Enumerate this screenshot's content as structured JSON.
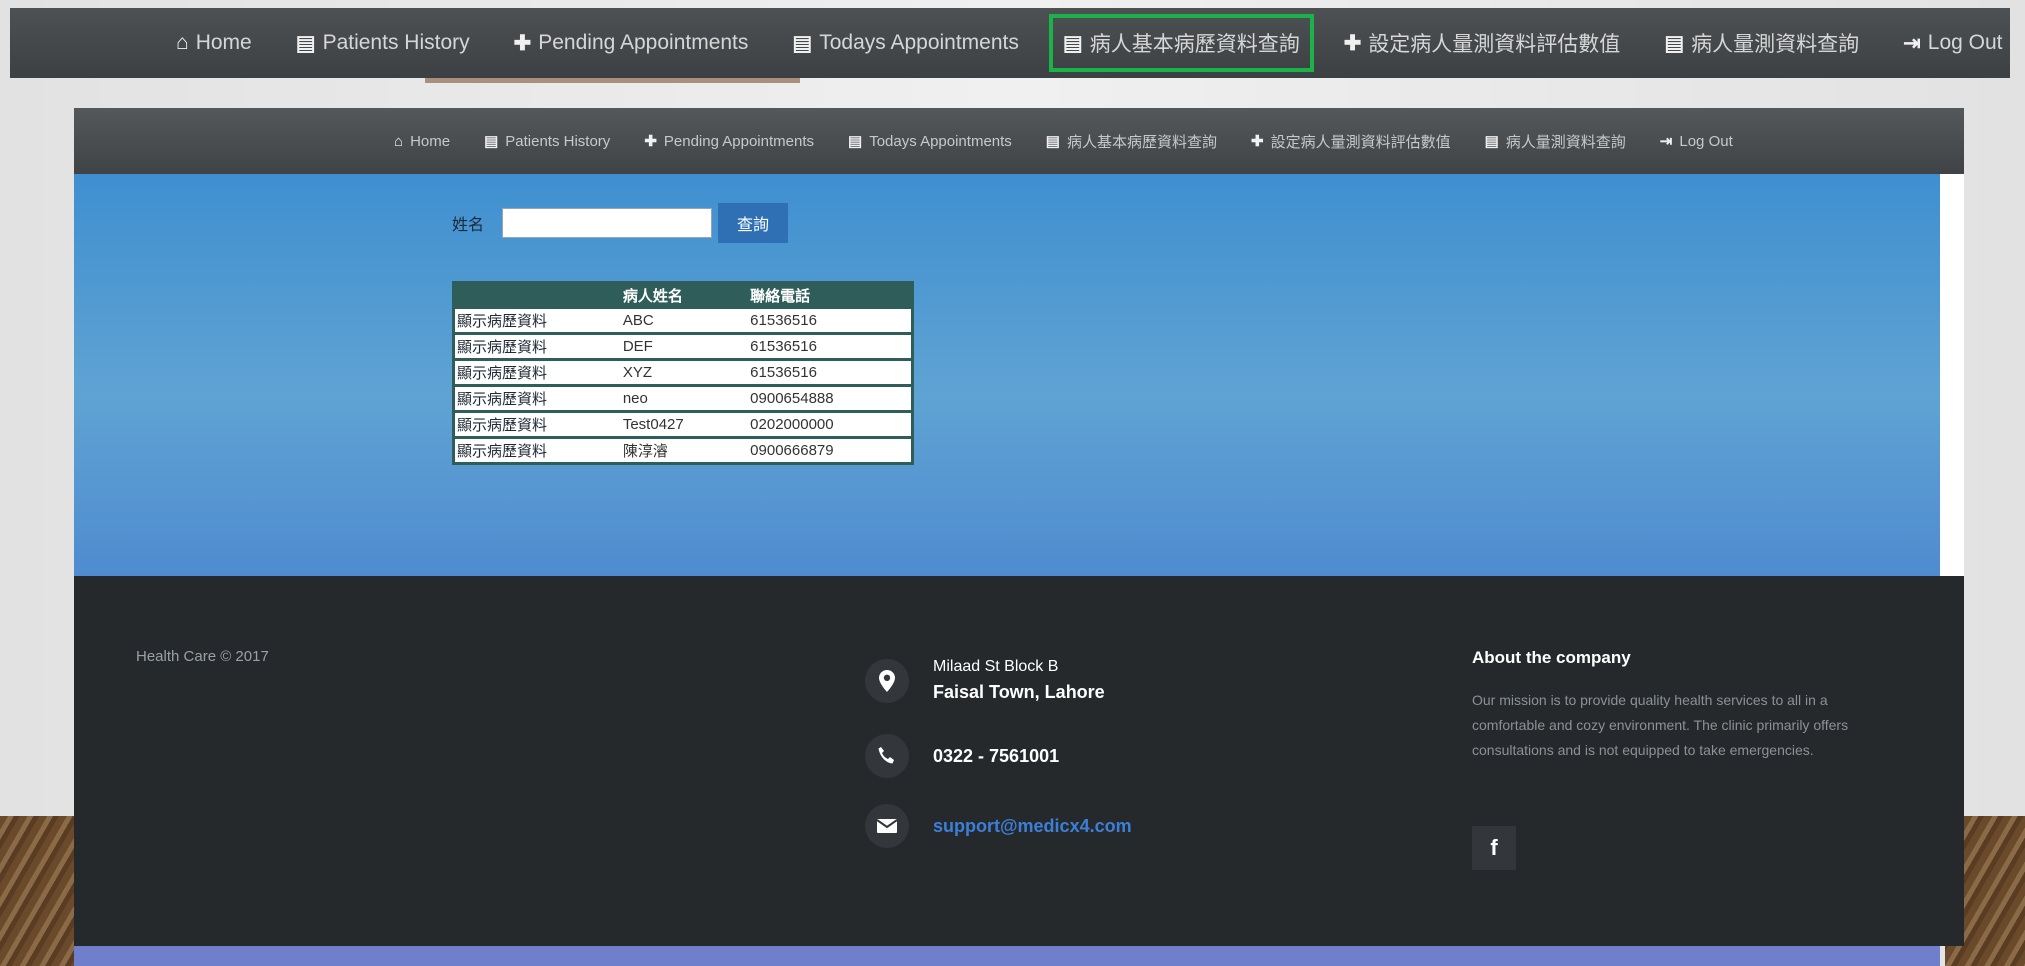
{
  "nav": {
    "items": [
      {
        "icon": "home-icon",
        "glyph": "⌂",
        "label": "Home"
      },
      {
        "icon": "list-icon",
        "glyph": "▤",
        "label": "Patients History"
      },
      {
        "icon": "plus-icon",
        "glyph": "✚",
        "label": "Pending Appointments"
      },
      {
        "icon": "list-icon",
        "glyph": "▤",
        "label": "Todays Appointments"
      },
      {
        "icon": "list-icon",
        "glyph": "▤",
        "label": "病人基本病歷資料查詢"
      },
      {
        "icon": "plus-icon",
        "glyph": "✚",
        "label": "設定病人量測資料評估數值"
      },
      {
        "icon": "list-icon",
        "glyph": "▤",
        "label": "病人量測資料查詢"
      },
      {
        "icon": "logout-icon",
        "glyph": "⇥",
        "label": "Log Out"
      }
    ],
    "highlighted": "病人基本病歷資料查詢",
    "highlight_color": "#19b347"
  },
  "search": {
    "label": "姓名",
    "value": "",
    "button_label": "查詢"
  },
  "table": {
    "headers": [
      "",
      "病人姓名",
      "聯絡電話"
    ],
    "rows": [
      {
        "link": "顯示病歷資料",
        "name": "ABC",
        "phone": "61536516"
      },
      {
        "link": "顯示病歷資料",
        "name": "DEF",
        "phone": "61536516"
      },
      {
        "link": "顯示病歷資料",
        "name": "XYZ",
        "phone": "61536516"
      },
      {
        "link": "顯示病歷資料",
        "name": "neo",
        "phone": "0900654888"
      },
      {
        "link": "顯示病歷資料",
        "name": "Test0427",
        "phone": "0202000000"
      },
      {
        "link": "顯示病歷資料",
        "name": "陳淳濬",
        "phone": "0900666879"
      }
    ]
  },
  "footer": {
    "copyright": "Health Care © 2017",
    "address_line1": "Milaad St Block B",
    "address_line2": "Faisal Town, Lahore",
    "phone": "0322 - 7561001",
    "email": "support@medicx4.com",
    "about_title": "About the company",
    "about_text": "Our mission is to provide quality health services to all in a comfortable and cozy environment. The clinic primarily offers consultations and is not equipped to take emergencies.",
    "facebook_glyph": "f"
  },
  "colors": {
    "navbar": "#3c4043",
    "hero": "#4f92d0",
    "footer": "#26292c",
    "table_header": "#2f5e5a",
    "search_button": "#2f6fb3",
    "email_link": "#3c7fd9"
  }
}
